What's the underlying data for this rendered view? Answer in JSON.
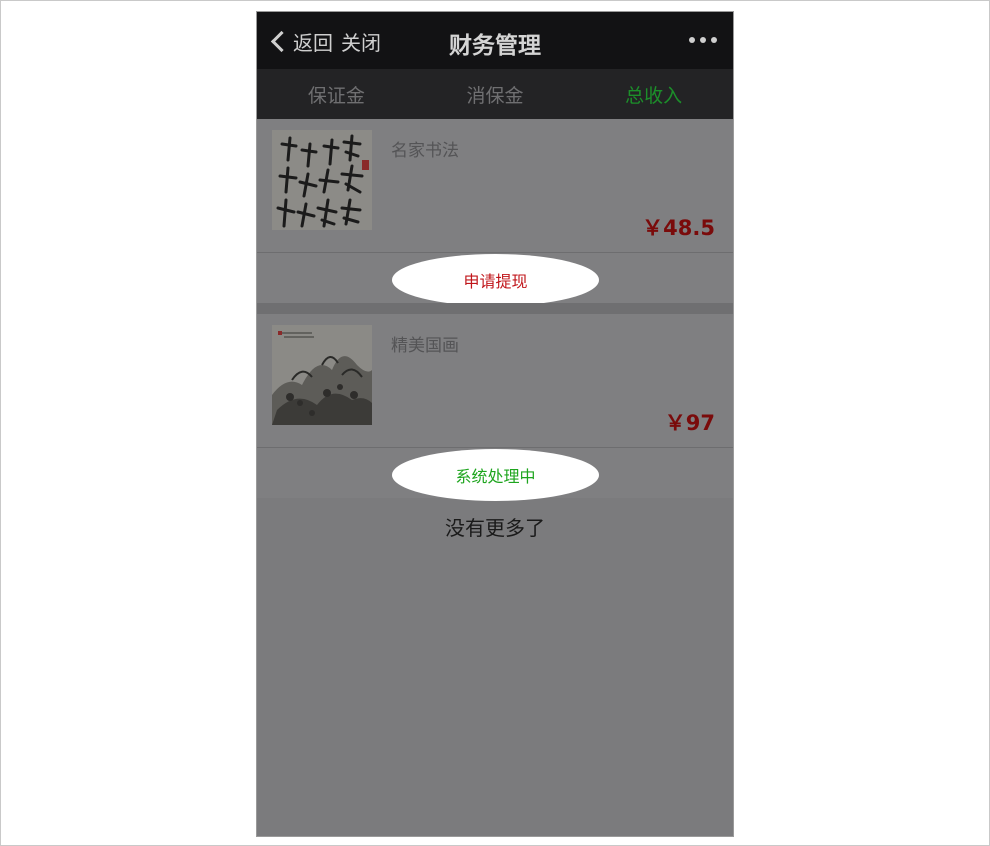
{
  "nav": {
    "back_label": "返回",
    "close_label": "关闭",
    "title": "财务管理"
  },
  "tabs": [
    {
      "label": "保证金",
      "active": false
    },
    {
      "label": "消保金",
      "active": false
    },
    {
      "label": "总收入",
      "active": true
    }
  ],
  "items": [
    {
      "title": "名家书法",
      "price": "￥48.5",
      "action_label": "申请提现",
      "action_color": "#c0151a",
      "thumb_icon": "calligraphy-image"
    },
    {
      "title": "精美国画",
      "price": "￥97",
      "action_label": "系统处理中",
      "action_color": "#1ea51e",
      "thumb_icon": "landscape-painting-image"
    }
  ],
  "footer": {
    "no_more_label": "没有更多了"
  },
  "colors": {
    "active_tab": "#1c8f2a",
    "price": "#7a0b0b"
  }
}
